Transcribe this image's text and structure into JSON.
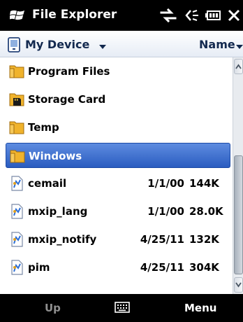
{
  "titlebar": {
    "title": "File Explorer",
    "icons": [
      "windows-start-icon",
      "data-connection-icon",
      "volume-icon",
      "battery-icon",
      "close-icon"
    ]
  },
  "header": {
    "location": "My Device",
    "sort_by": "Name"
  },
  "files": [
    {
      "name": "Program Files",
      "type": "folder",
      "date": "",
      "size": "",
      "selected": false
    },
    {
      "name": "Storage Card",
      "type": "storage-folder",
      "date": "",
      "size": "",
      "selected": false
    },
    {
      "name": "Temp",
      "type": "folder",
      "date": "",
      "size": "",
      "selected": false
    },
    {
      "name": "Windows",
      "type": "folder",
      "date": "",
      "size": "",
      "selected": true
    },
    {
      "name": "cemail",
      "type": "file",
      "date": "1/1/00",
      "size": "144K",
      "selected": false
    },
    {
      "name": "mxip_lang",
      "type": "file",
      "date": "1/1/00",
      "size": "28.0K",
      "selected": false
    },
    {
      "name": "mxip_notify",
      "type": "file",
      "date": "4/25/11",
      "size": "132K",
      "selected": false
    },
    {
      "name": "pim",
      "type": "file",
      "date": "4/25/11",
      "size": "304K",
      "selected": false
    }
  ],
  "softkeys": {
    "left": "Up",
    "center_icon": "keyboard-icon",
    "right": "Menu"
  },
  "colors": {
    "selection": "#2a5cc0",
    "folder": "#f0b32c",
    "titlebar": "#000000",
    "disabled_softkey": "#8f8f8f"
  }
}
